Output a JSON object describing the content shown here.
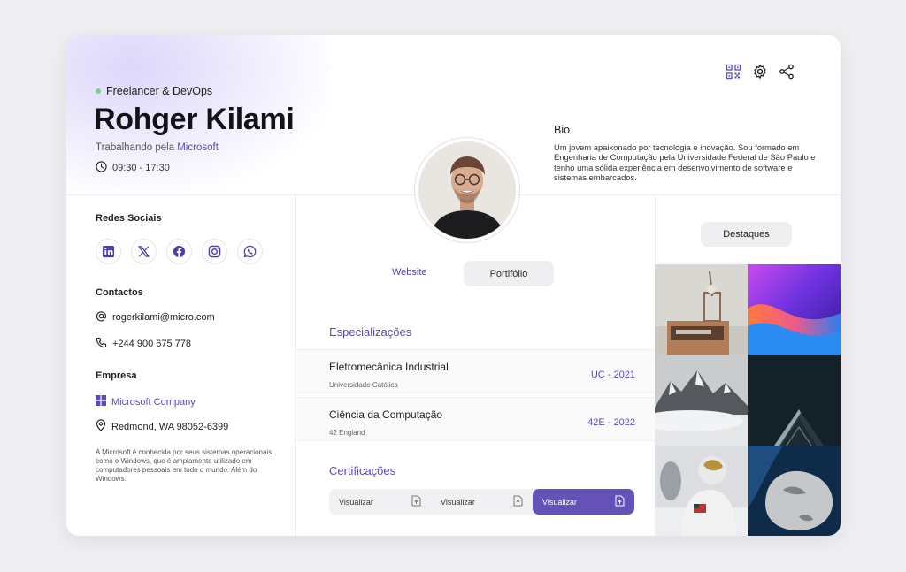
{
  "profile": {
    "role": "Freelancer & DevOps",
    "name": "Rohger Kilami",
    "work_prefix": "Trabalhando pela",
    "work_company": "Microsoft",
    "hours": "09:30 - 17:30"
  },
  "toolbar": {
    "icons": [
      "qr-code-icon",
      "gear-icon",
      "share-icon"
    ]
  },
  "bio": {
    "title": "Bio",
    "text": "Um jovem apaixonado por tecnologia e inovação. Sou formado em Engenharia de Computação pela Universidade Federal de São Paulo e tenho uma sólida experiência em desenvolvimento de software e sistemas embarcados."
  },
  "social": {
    "title": "Redes Sociais",
    "icons": [
      "linkedin-icon",
      "x-icon",
      "facebook-icon",
      "instagram-icon",
      "whatsapp-icon"
    ]
  },
  "contacts": {
    "title": "Contactos",
    "email": "rogerkilami@micro.com",
    "phone": "+244 900 675 778"
  },
  "company": {
    "title": "Empresa",
    "name": "Microsoft Company",
    "address": "Redmond, WA 98052-6399",
    "about": "A Microsoft é conhecida por seus sistemas operacionais, como o Windows, que é amplamente utilizado em computadores pessoais em todo o mundo. Além do Windows."
  },
  "tabs": {
    "website": "Website",
    "portfolio": "Portifólio"
  },
  "specializations": {
    "title": "Especializações",
    "items": [
      {
        "title": "Eletromecânica Industrial",
        "sub": "Universidade Católica",
        "code": "UC - 2021"
      },
      {
        "title": "Ciência da Computação",
        "sub": "42 England",
        "code": "42E - 2022"
      }
    ]
  },
  "certifications": {
    "title": "Certificações",
    "buttons": [
      "Visualizar",
      "Visualizar",
      "Visualizar"
    ]
  },
  "highlights": {
    "button": "Destaques"
  },
  "colors": {
    "accent": "#6552b9",
    "accent_text": "#5a4bb7",
    "status_dot": "#7bd389"
  }
}
